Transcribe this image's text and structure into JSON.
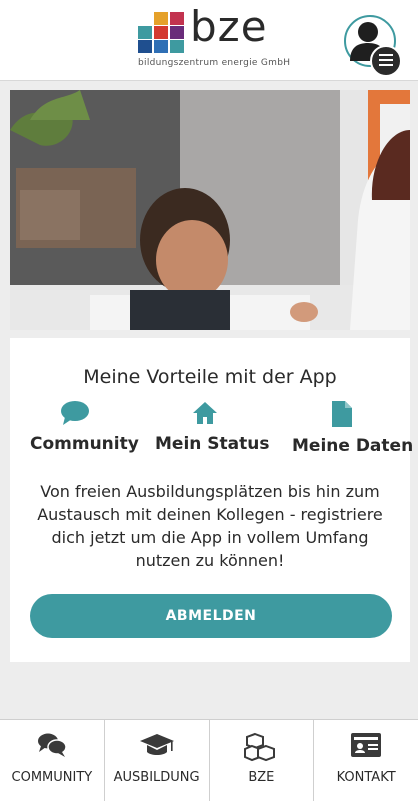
{
  "header": {
    "logo_word": "bze",
    "logo_subtitle": "bildungszentrum energie GmbH",
    "logo_colors": [
      "#d33a2f",
      "#6a2c7a",
      "#e5a12a",
      "#3e9aa0",
      "#1f4f8f",
      "#c2334f"
    ],
    "avatar_icon": "user-icon",
    "menu_icon": "hamburger-menu-icon"
  },
  "hero": {
    "image_icon": "hero-photo"
  },
  "card": {
    "title": "Meine Vorteile mit der App",
    "features": [
      {
        "icon": "chat-bubble-icon",
        "label": "Community"
      },
      {
        "icon": "home-icon",
        "label": "Mein Status"
      },
      {
        "icon": "document-icon",
        "label": "Meine Daten"
      }
    ],
    "description": "Von freien Ausbildungsplätzen bis hin zum Austausch mit deinen Kollegen - registriere dich jetzt um die App in vollem Umfang nutzen zu können!",
    "button_label": "ABMELDEN",
    "accent_color": "#3e9aa0"
  },
  "bottom_nav": [
    {
      "icon": "chat-bubbles-icon",
      "label": "COMMUNITY"
    },
    {
      "icon": "graduation-cap-icon",
      "label": "AUSBILDUNG"
    },
    {
      "icon": "cubes-icon",
      "label": "BZE"
    },
    {
      "icon": "contact-card-icon",
      "label": "KONTAKT"
    }
  ]
}
